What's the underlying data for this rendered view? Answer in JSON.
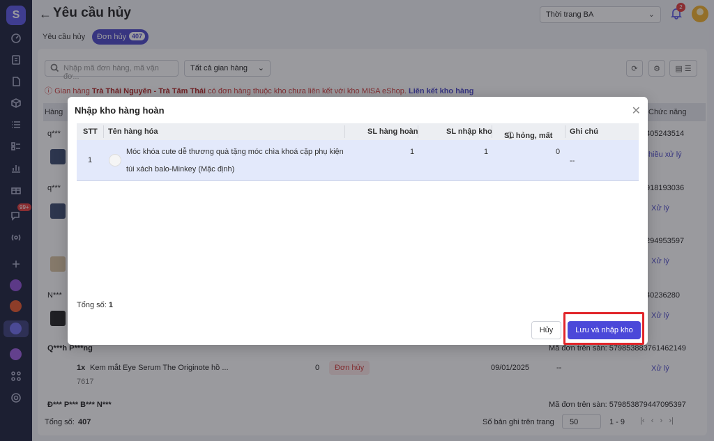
{
  "page": {
    "title": "Yêu cầu hủy",
    "store": "Thời trang BA",
    "notification_count": "2",
    "tabs": [
      {
        "label": "Yêu cầu hủy"
      },
      {
        "label": "Đơn hủy",
        "count": "407"
      }
    ],
    "search_placeholder": "Nhập mã đơn hàng, mã vận đơ...",
    "filter_label": "Tất cả gian hàng",
    "warning": {
      "prefix": "Gian hàng",
      "store_name": "Trà Thái Nguyên - Trà Tâm Thái",
      "suffix": "có đơn hàng thuộc kho chưa liên kết với kho MISA eShop.",
      "link": "Liên kết kho hàng"
    },
    "bg_header": {
      "col1": "Hàng",
      "col_last": "Chức năng"
    },
    "bg_rows": [
      {
        "customer": "q***",
        "order": "405243514",
        "action": "Chiều xử lý"
      },
      {
        "customer": "q***",
        "order": "918193036",
        "action": "Xử lý"
      },
      {
        "customer": "",
        "order": "294953597",
        "action": "Xử lý"
      },
      {
        "customer": "N***",
        "order": "40236280",
        "action": "Xử lý"
      }
    ],
    "bg_order_5": {
      "customer": "Q***h P***ng",
      "order_label": "Mã đơn trên sàn: 579853883761462149",
      "qty": "1x",
      "product": "Kem mắt Eye Serum The Originote hồ ...",
      "sku": "7617",
      "zero": "0",
      "status": "Đơn hủy",
      "date": "09/01/2025",
      "dash": "--",
      "action": "Xử lý"
    },
    "bg_order_6": {
      "customer": "Đ*** P*** B*** N***",
      "order_label": "Mã đơn trên sàn: 579853879447095397"
    },
    "footer": {
      "total_label": "Tổng số:",
      "total_value": "407",
      "per_page_label": "Số bản ghi trên trang",
      "per_page_value": "50",
      "range": "1 - 9"
    },
    "sidebar_badge": "99+"
  },
  "modal": {
    "title": "Nhập kho hàng hoàn",
    "columns": {
      "stt": "STT",
      "name": "Tên hàng hóa",
      "returned": "SL hàng hoàn",
      "imported": "SL nhập kho",
      "damaged": "SL hỏng, mất",
      "note": "Ghi chú"
    },
    "rows": [
      {
        "stt": "1",
        "name_line1": "Móc khóa cute dễ thương quà tặng móc chìa khoá cặp phụ kiện",
        "name_line2": "túi xách balo-Minkey (Mặc định)",
        "returned": "1",
        "imported": "1",
        "damaged": "0",
        "note": "--"
      }
    ],
    "total_label": "Tổng số:",
    "total_value": "1",
    "cancel_label": "Hủy",
    "save_label": "Lưu và nhập kho"
  },
  "colors": {
    "accent": "#4b48d9",
    "highlight": "#e1262b",
    "warning": "#d23b3b",
    "selected_row": "#e3e9fb"
  }
}
